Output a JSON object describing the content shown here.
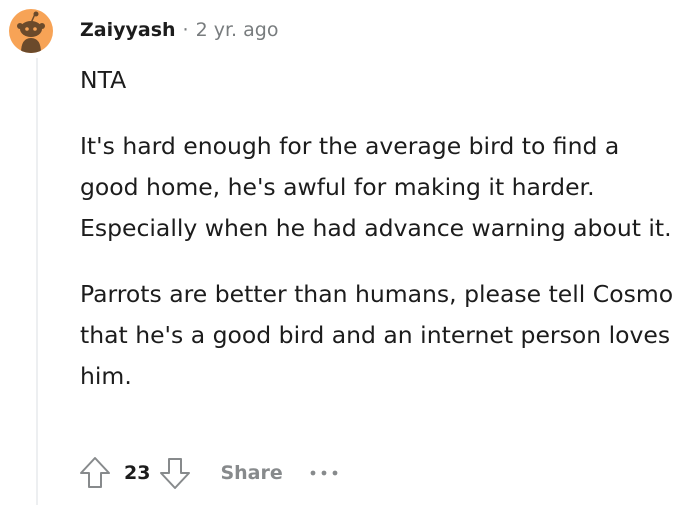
{
  "comment": {
    "username": "Zaiyyash",
    "separator": "·",
    "time": "2 yr. ago",
    "paragraphs": [
      "NTA",
      "It's hard enough for the average bird to find a good home, he's awful for making it harder. Especially when he had advance warning about it.",
      "Parrots are better than humans, please tell Cosmo that he's a good bird and an internet person loves him."
    ],
    "actions": {
      "upvote_icon": "upvote-arrow-icon",
      "score": "23",
      "downvote_icon": "downvote-arrow-icon",
      "share_label": "Share",
      "more_icon": "more-options-icon"
    }
  },
  "colors": {
    "avatar_bg": "#f7a356",
    "meta_gray": "#787c7e",
    "action_gray": "#878a8c",
    "thread_line": "#edeff1"
  }
}
